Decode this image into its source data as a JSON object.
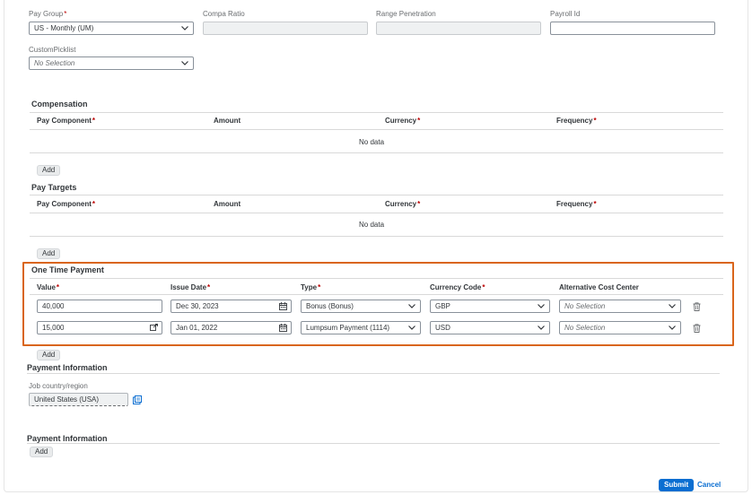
{
  "top_fields": {
    "pay_group": {
      "label": "Pay Group",
      "value": "US - Monthly (UM)"
    },
    "compa_ratio": {
      "label": "Compa Ratio",
      "value": ""
    },
    "range_penetration": {
      "label": "Range Penetration",
      "value": ""
    },
    "payroll_id": {
      "label": "Payroll Id",
      "value": ""
    },
    "custom_picklist": {
      "label": "CustomPicklist",
      "value": "No Selection"
    }
  },
  "compensation": {
    "title": "Compensation",
    "headers": [
      "Pay Component",
      "Amount",
      "Currency",
      "Frequency"
    ],
    "empty_text": "No data",
    "add_label": "Add"
  },
  "pay_targets": {
    "title": "Pay Targets",
    "headers": [
      "Pay Component",
      "Amount",
      "Currency",
      "Frequency"
    ],
    "empty_text": "No data",
    "add_label": "Add"
  },
  "one_time_payment": {
    "title": "One Time Payment",
    "headers": [
      "Value",
      "Issue Date",
      "Type",
      "Currency Code",
      "Alternative Cost Center"
    ],
    "rows": [
      {
        "value": "40,000",
        "issue_date": "Dec 30, 2023",
        "type": "Bonus (Bonus)",
        "currency": "GBP",
        "cost_center": "No Selection"
      },
      {
        "value": "15,000",
        "issue_date": "Jan 01, 2022",
        "type": "Lumpsum Payment (1114)",
        "currency": "USD",
        "cost_center": "No Selection"
      }
    ],
    "add_label": "Add",
    "highlight_color": "#d9651b"
  },
  "payment_information_1": {
    "title": "Payment Information",
    "job_country_label": "Job country/region",
    "job_country_value": "United States (USA)"
  },
  "payment_information_2": {
    "title": "Payment Information",
    "add_label": "Add"
  },
  "footer": {
    "submit_label": "Submit",
    "cancel_label": "Cancel"
  },
  "colors": {
    "accent": "#0a6ed1",
    "required": "#bb0000"
  }
}
